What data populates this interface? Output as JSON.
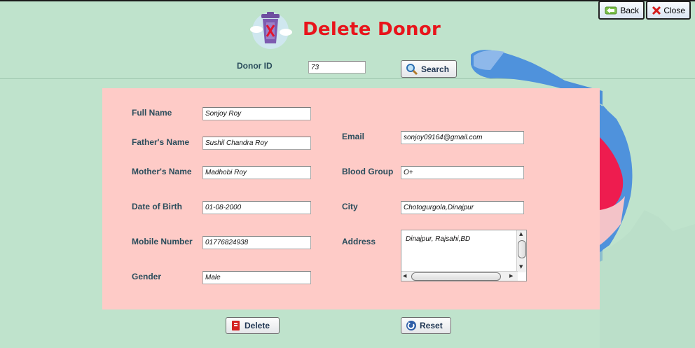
{
  "window": {
    "back_label": "Back",
    "close_label": "Close"
  },
  "header": {
    "title": "Delete Donor",
    "icon": "trash-bin-icon"
  },
  "search": {
    "label": "Donor ID",
    "value": "73",
    "button_label": "Search"
  },
  "form": {
    "full_name_label": "Full Name",
    "full_name": "Sonjoy Roy",
    "father_label": "Father's Name",
    "father": "Sushil Chandra Roy",
    "mother_label": "Mother's Name",
    "mother": "Madhobi Roy",
    "dob_label": "Date of Birth",
    "dob": "01-08-2000",
    "mobile_label": "Mobile Number",
    "mobile": "01776824938",
    "gender_label": "Gender",
    "gender": "Male",
    "email_label": "Email",
    "email": "sonjoy09164@gmail.com",
    "blood_label": "Blood Group",
    "blood": "O+",
    "city_label": "City",
    "city": "Chotogurgola,Dinajpur",
    "address_label": "Address",
    "address": "Dinajpur, Rajsahi,BD"
  },
  "actions": {
    "delete_label": "Delete",
    "reset_label": "Reset"
  },
  "colors": {
    "title": "#e8141b",
    "panel": "#fecbc7",
    "background": "#bfe3cc",
    "label": "#2b4d5c"
  }
}
